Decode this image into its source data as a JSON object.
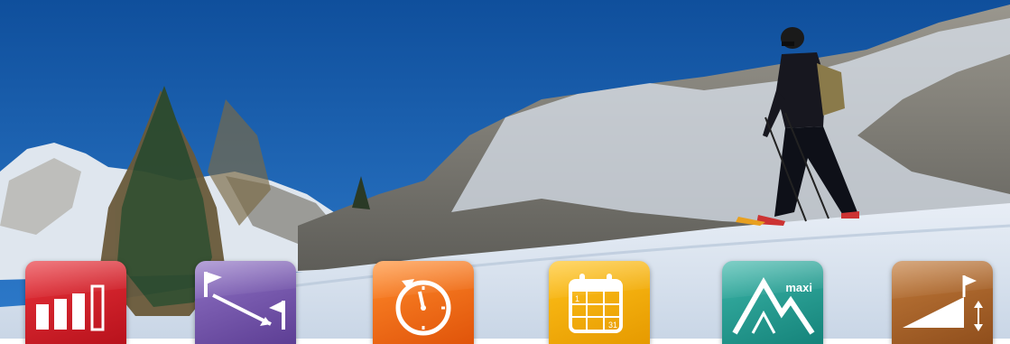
{
  "icons": {
    "difficulty": "bar-chart-icon",
    "route": "route-flags-icon",
    "duration": "stopwatch-icon",
    "season": "calendar-icon",
    "altitude": "mountain-icon",
    "elevation_gain": "elevation-gain-icon"
  },
  "calendar": {
    "day_first": "1",
    "day_last": "31"
  },
  "altitude_tile": {
    "label": "maxi"
  },
  "colors": {
    "sky": "#1b5fae",
    "difficulty": "#d42029",
    "route": "#6e4fa8",
    "duration": "#f06a14",
    "season": "#f5a800",
    "altitude": "#23978d",
    "elevation_gain": "#a6622a"
  }
}
